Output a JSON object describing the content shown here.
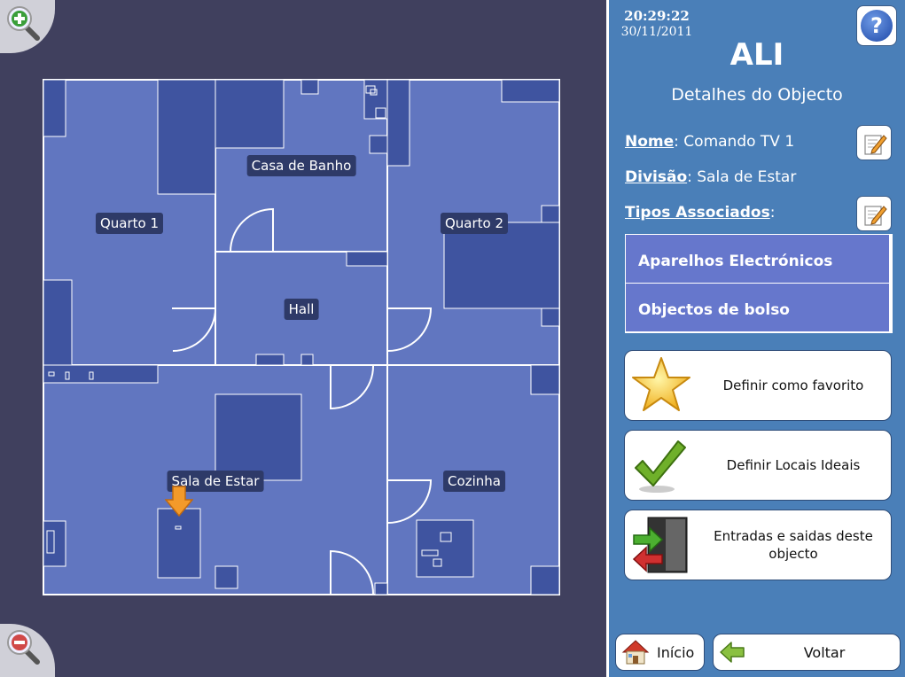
{
  "map": {
    "rooms": [
      {
        "name": "Quarto 1"
      },
      {
        "name": "Casa de Banho"
      },
      {
        "name": "Quarto 2"
      },
      {
        "name": "Hall"
      },
      {
        "name": "Sala de Estar"
      },
      {
        "name": "Cozinha"
      }
    ],
    "zoom_in_icon": "zoom-in-icon",
    "zoom_out_icon": "zoom-out-icon",
    "marker_icon": "down-arrow-icon"
  },
  "panel": {
    "time": "20:29:22",
    "date": "30/11/2011",
    "title": "ALI",
    "subtitle": "Detalhes do Objecto",
    "help_icon": "question-icon",
    "fields": {
      "nome_label": "Nome",
      "nome_value": "Comando TV 1",
      "divisao_label": "Divisão",
      "divisao_value": "Sala de Estar",
      "tipos_label": "Tipos Associados"
    },
    "types": [
      "Aparelhos Electrónicos",
      "Objectos de bolso"
    ],
    "actions": {
      "favorite": "Definir como favorito",
      "ideal_locations": "Definir Locais Ideais",
      "entries_exits": "Entradas e saidas deste objecto"
    },
    "nav": {
      "home": "Início",
      "back": "Voltar"
    }
  }
}
